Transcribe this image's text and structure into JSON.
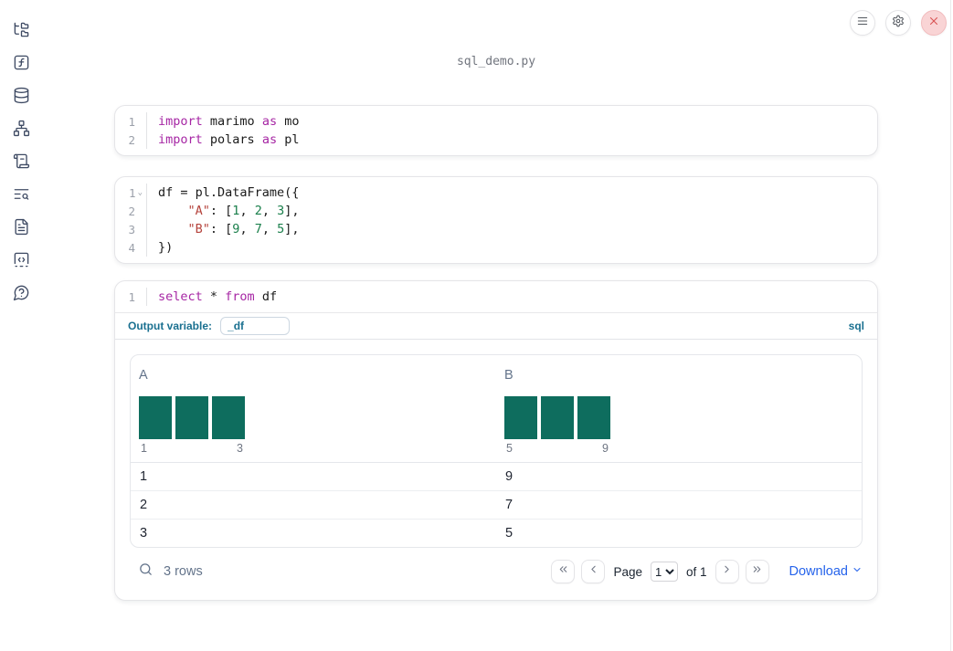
{
  "window": {
    "title": "sql_demo.py"
  },
  "topbar": {
    "buttons": [
      "menu",
      "settings",
      "close"
    ]
  },
  "sidebar": {
    "items": [
      {
        "icon": "folder-tree-icon"
      },
      {
        "icon": "function-square-icon"
      },
      {
        "icon": "database-icon"
      },
      {
        "icon": "network-icon"
      },
      {
        "icon": "scroll-icon"
      },
      {
        "icon": "text-search-icon"
      },
      {
        "icon": "file-text-icon"
      },
      {
        "icon": "code-square-icon"
      },
      {
        "icon": "help-circle-icon"
      }
    ]
  },
  "cells": {
    "imports": {
      "lines": [
        {
          "num": "1",
          "tokens": [
            [
              "kw",
              "import"
            ],
            [
              "pl",
              " marimo "
            ],
            [
              "kw",
              "as"
            ],
            [
              "pl",
              " mo"
            ]
          ]
        },
        {
          "num": "2",
          "tokens": [
            [
              "kw",
              "import"
            ],
            [
              "pl",
              " polars "
            ],
            [
              "kw",
              "as"
            ],
            [
              "pl",
              " pl"
            ]
          ]
        }
      ]
    },
    "dataframe": {
      "lines": [
        {
          "num": "1",
          "fold": true,
          "tokens": [
            [
              "pl",
              "df = pl.DataFrame({"
            ]
          ]
        },
        {
          "num": "2",
          "tokens": [
            [
              "pl",
              "    "
            ],
            [
              "str",
              "\"A\""
            ],
            [
              "pl",
              ": ["
            ],
            [
              "num",
              "1"
            ],
            [
              "pl",
              ", "
            ],
            [
              "num",
              "2"
            ],
            [
              "pl",
              ", "
            ],
            [
              "num",
              "3"
            ],
            [
              "pl",
              "],"
            ]
          ]
        },
        {
          "num": "3",
          "tokens": [
            [
              "pl",
              "    "
            ],
            [
              "str",
              "\"B\""
            ],
            [
              "pl",
              ": ["
            ],
            [
              "num",
              "9"
            ],
            [
              "pl",
              ", "
            ],
            [
              "num",
              "7"
            ],
            [
              "pl",
              ", "
            ],
            [
              "num",
              "5"
            ],
            [
              "pl",
              "],"
            ]
          ]
        },
        {
          "num": "4",
          "tokens": [
            [
              "pl",
              "})"
            ]
          ]
        }
      ]
    },
    "sql": {
      "lines": [
        {
          "num": "1",
          "tokens": [
            [
              "kw",
              "select"
            ],
            [
              "pl",
              " * "
            ],
            [
              "kw",
              "from"
            ],
            [
              "pl",
              " df"
            ]
          ]
        }
      ],
      "output_variable_label": "Output variable:",
      "output_variable_value": "_df",
      "language_badge": "sql"
    }
  },
  "table": {
    "columns": [
      {
        "name": "A",
        "hist": {
          "bars": [
            1,
            1,
            1
          ],
          "min_label": "1",
          "max_label": "3"
        }
      },
      {
        "name": "B",
        "hist": {
          "bars": [
            1,
            1,
            1
          ],
          "min_label": "5",
          "max_label": "9"
        }
      }
    ],
    "rows": [
      [
        "1",
        "9"
      ],
      [
        "2",
        "7"
      ],
      [
        "3",
        "5"
      ]
    ],
    "row_count_text": "3 rows",
    "pagination": {
      "page_label": "Page",
      "page_value": "1",
      "of_label": "of 1"
    },
    "download_label": "Download"
  },
  "colors": {
    "keyword": "#a626a4",
    "string": "#b5433c",
    "number": "#1a7f4b",
    "histogram_bar": "#0e6d5e",
    "output_variable_accent": "#1a7090",
    "download_link": "#2563eb",
    "close_button_bg": "#f9d4d5",
    "close_button_x": "#d95353",
    "sidebar_icon": "#3e4a63"
  }
}
